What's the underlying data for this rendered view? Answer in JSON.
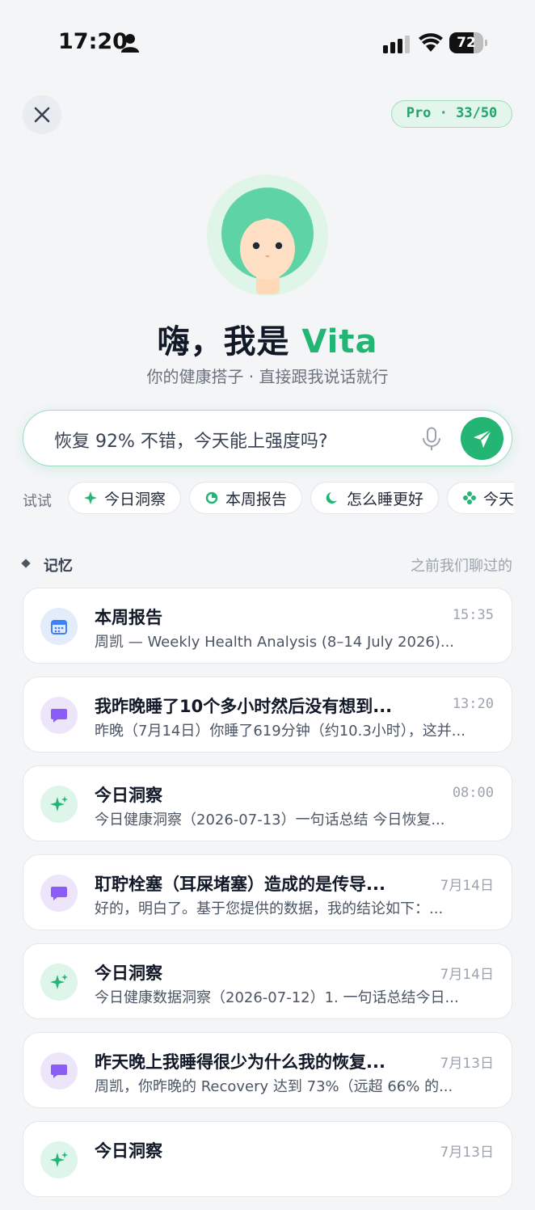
{
  "status_bar": {
    "time": "17:20",
    "battery": "72",
    "battery_level": 0.72
  },
  "header": {
    "close_icon": "close-icon",
    "pro_badge": "Pro · 33/50"
  },
  "hero": {
    "greeting_prefix": "嗨，我是 ",
    "greeting_name": "Vita",
    "subtitle": "你的健康搭子 · 直接跟我说话就行"
  },
  "input": {
    "value": "恢复 92% 不错，今天能上强度吗?",
    "mic_icon": "mic-icon",
    "send_icon": "send-icon"
  },
  "suggestions": {
    "label": "试试",
    "chips": [
      {
        "label": "今日洞察",
        "icon": "sparkle-icon"
      },
      {
        "label": "本周报告",
        "icon": "pie-icon"
      },
      {
        "label": "怎么睡更好",
        "icon": "moon-icon"
      },
      {
        "label": "今天",
        "icon": "flower-icon"
      }
    ]
  },
  "memory": {
    "title": "记忆",
    "subtitle": "之前我们聊过的",
    "items": [
      {
        "type": "calendar",
        "title": "本周报告",
        "time": "15:35",
        "preview": "周凯 — Weekly Health Analysis (8–14 July 2026)..."
      },
      {
        "type": "chat",
        "title": "我昨晚睡了10个多小时然后没有想到...",
        "time": "13:20",
        "preview": "昨晚（7月14日）你睡了619分钟（约10.3小时），这并..."
      },
      {
        "type": "spark",
        "title": "今日洞察",
        "time": "08:00",
        "preview": "今日健康洞察（2026-07-13）一句话总结 今日恢复..."
      },
      {
        "type": "chat",
        "title": "耵聍栓塞（耳屎堵塞）造成的是传导...",
        "time": "7月14日",
        "preview": "好的，明白了。基于您提供的数据，我的结论如下：..."
      },
      {
        "type": "spark",
        "title": "今日洞察",
        "time": "7月14日",
        "preview": "今日健康数据洞察（2026-07-12）1. 一句话总结今日..."
      },
      {
        "type": "chat",
        "title": "昨天晚上我睡得很少为什么我的恢复...",
        "time": "7月13日",
        "preview": "周凯，你昨晚的 Recovery 达到 73%（远超 66% 的..."
      },
      {
        "type": "spark",
        "title": "今日洞察",
        "time": "7月13日",
        "preview": ""
      }
    ]
  },
  "colors": {
    "accent": "#22b573",
    "background": "#f3f5f7"
  }
}
